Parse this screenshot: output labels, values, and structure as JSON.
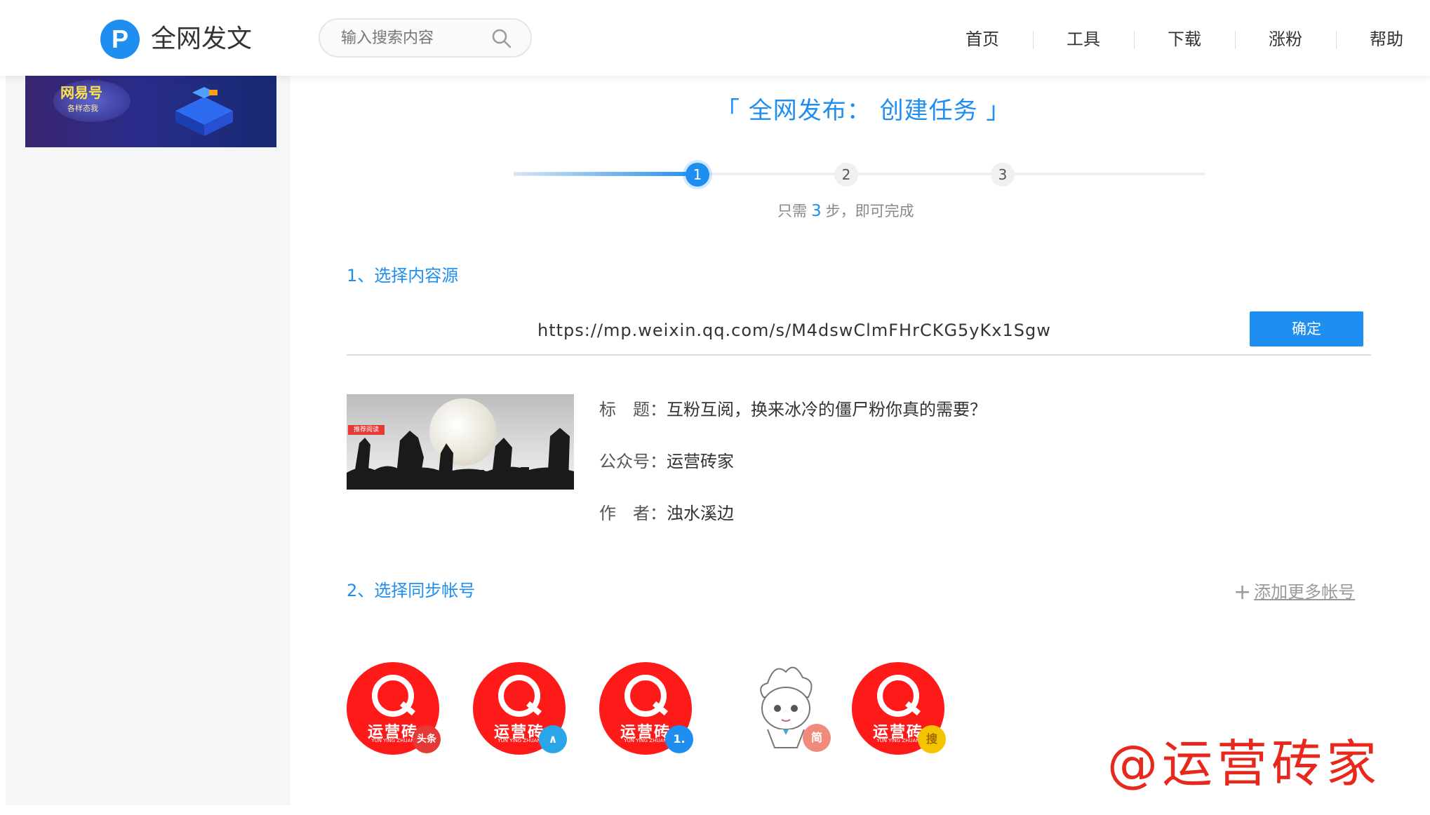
{
  "header": {
    "logo_letter": "P",
    "brand": "全网发文",
    "search_placeholder": "输入搜索内容",
    "nav": [
      "首页",
      "工具",
      "下载",
      "涨粉",
      "帮助"
    ]
  },
  "sidebar": {
    "banner_title": "网易号",
    "banner_sub": "各样态我"
  },
  "main": {
    "title": "「 全网发布： 创建任务 」",
    "steps": [
      "1",
      "2",
      "3"
    ],
    "steps_caption_pre": "只需",
    "steps_caption_num": "3",
    "steps_caption_post": "步，即可完成",
    "section1": "1、选择内容源",
    "url": "https://mp.weixin.qq.com/s/M4dswClmFHrCKG5yKx1Sgw",
    "confirm": "确定",
    "article": {
      "title_label": "标　题：",
      "title": "互粉互阅，换来冰冷的僵尸粉你真的需要？",
      "account_label": "公众号：",
      "account": "运营砖家",
      "author_label": "作　者：",
      "author": "浊水溪边",
      "thumb_tag": "推荐阅读"
    },
    "section2": "2、选择同步帐号",
    "add_more": "添加更多帐号",
    "accounts": [
      {
        "brand": "运营砖",
        "badge": "头条",
        "badge_color": "#e53935"
      },
      {
        "brand": "运营砖",
        "badge": "∧",
        "badge_color": "#2aa5e8"
      },
      {
        "brand": "运营砖",
        "badge": "1.",
        "badge_color": "#1e8ef0"
      },
      {
        "brand": "",
        "badge": "简",
        "badge_color": "#f08a7a"
      },
      {
        "brand": "运营砖",
        "badge": "搜",
        "badge_color": "#f5c400"
      }
    ],
    "account_mini": "YUN YING ZHUAN"
  },
  "watermark": "@运营砖家",
  "colors": {
    "accent": "#1e8ef0",
    "account_red": "#ff1a1a",
    "watermark": "#e8281c"
  }
}
